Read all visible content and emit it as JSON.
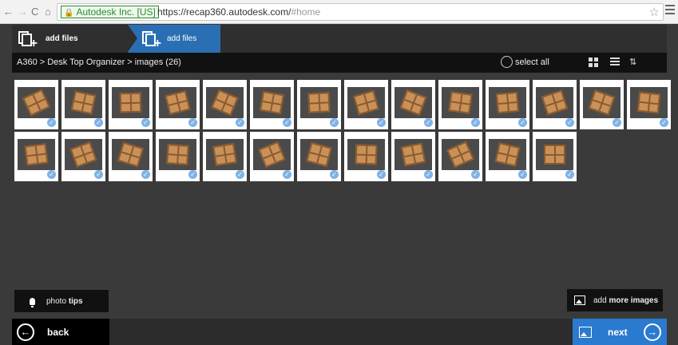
{
  "browser": {
    "site_identity": "Autodesk Inc. [US]",
    "url_base": "https://recap360.autodesk.com/",
    "url_hash": "#home"
  },
  "steps": [
    {
      "label": "add files"
    },
    {
      "label": "add files"
    }
  ],
  "breadcrumb": "A360 > Desk Top Organizer > images (26)",
  "select_all_label": "select all",
  "thumbnails": [
    "img01",
    "img02",
    "img03",
    "img04",
    "img05",
    "img06",
    "img07",
    "img08",
    "img09",
    "img10",
    "img11",
    "img12",
    "img13",
    "img14",
    "img15",
    "img16",
    "img17",
    "img18",
    "img19",
    "img20",
    "img21",
    "img22",
    "img23",
    "img24",
    "img25",
    "img26"
  ],
  "photo_tips": {
    "prefix": "photo ",
    "bold": "tips"
  },
  "add_more": {
    "prefix": "add ",
    "bold": "more images"
  },
  "back_label": "back",
  "next_label": "next",
  "colors": {
    "accent": "#2a6fb3",
    "next": "#2a7ad0",
    "background": "#3a3a3a"
  },
  "icons": [
    "back-arrow-icon",
    "forward-arrow-icon",
    "reload-icon",
    "home-icon",
    "lock-icon",
    "star-icon",
    "menu-icon",
    "add-files-icon",
    "circle-icon",
    "grid-view-icon",
    "list-view-icon",
    "sort-icon",
    "check-icon",
    "lightbulb-icon",
    "image-icon",
    "arrow-left-circle-icon",
    "arrow-right-circle-icon"
  ]
}
